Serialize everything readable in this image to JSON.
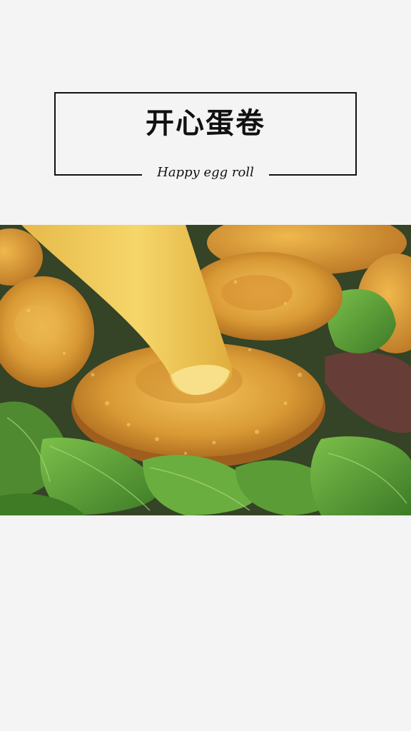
{
  "title": {
    "main": "开心蛋卷",
    "subtitle": "Happy egg roll"
  },
  "photo": {
    "icon": "fried-egg-rolls-on-salad-photo"
  },
  "colors": {
    "background": "#f4f4f4",
    "frame": "#111111",
    "sauce": "#f2c94c",
    "crust": "#d99a35",
    "greens": "#5f9c3a"
  }
}
